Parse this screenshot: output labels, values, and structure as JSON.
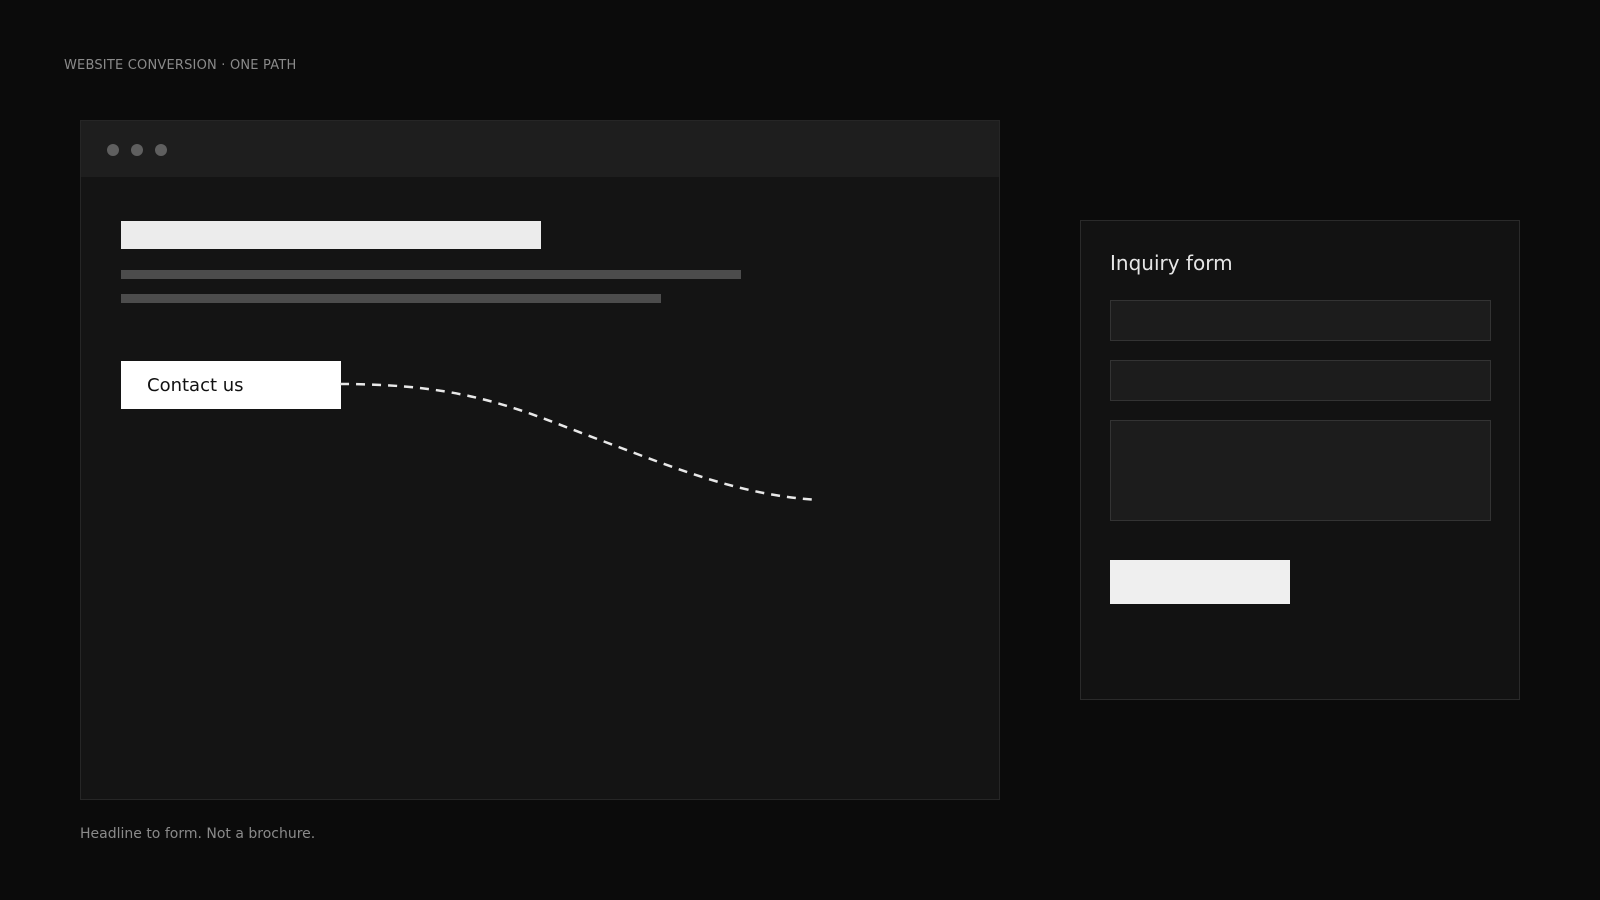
{
  "header": {
    "eyebrow": "WEBSITE CONVERSION · ONE PATH"
  },
  "browser": {
    "cta_label": "Contact us"
  },
  "form": {
    "title": "Inquiry form"
  },
  "footer": {
    "caption": "Headline to form. Not a brochure."
  },
  "colors": {
    "background": "#0b0b0b",
    "browser_body": "#141414",
    "browser_bar": "#1e1e1e",
    "headline_block": "#ececec",
    "text_line": "#4c4c4c",
    "cta": "#ffffff",
    "path_stroke": "#e8e8e8"
  }
}
